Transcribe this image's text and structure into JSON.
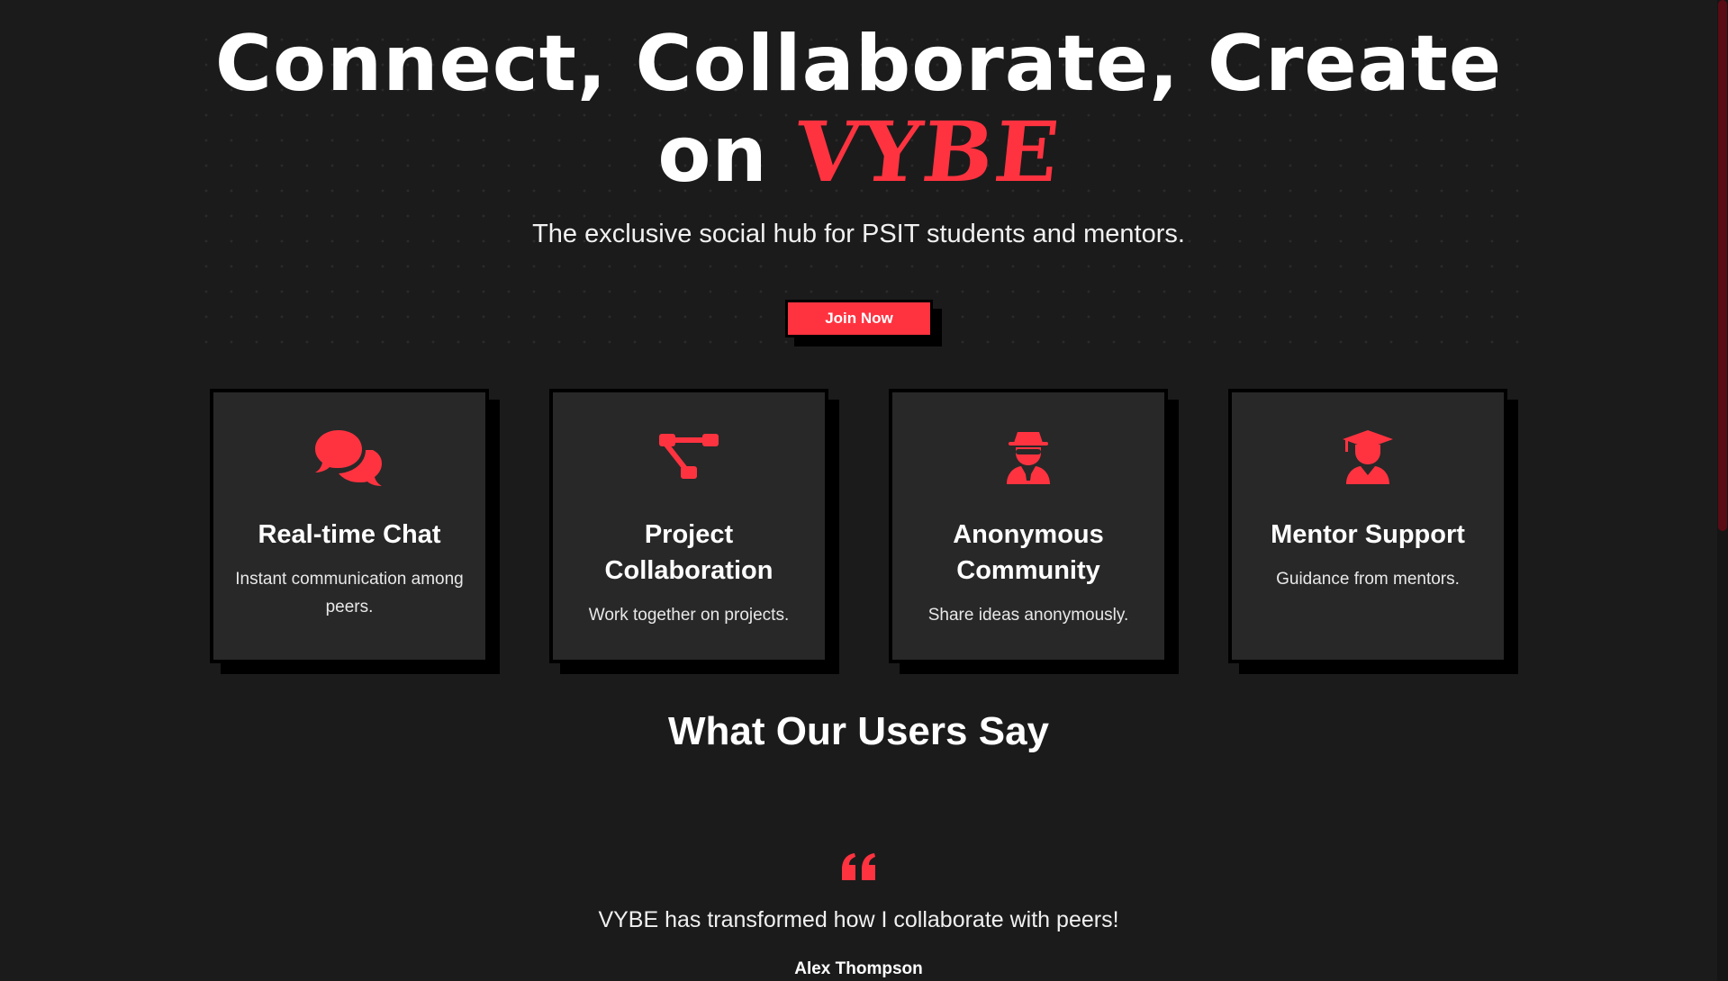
{
  "hero": {
    "title_line1": "Connect, Collaborate, Create",
    "title_line2_prefix": "on",
    "brand": "VYBE",
    "subtitle": "The exclusive social hub for PSIT students and mentors.",
    "cta_label": "Join Now"
  },
  "features": [
    {
      "icon": "chat-bubbles-icon",
      "title": "Real-time Chat",
      "description": "Instant communication among peers."
    },
    {
      "icon": "project-diagram-icon",
      "title": "Project Collaboration",
      "description": "Work together on projects."
    },
    {
      "icon": "user-secret-icon",
      "title": "Anonymous Community",
      "description": "Share ideas anonymously."
    },
    {
      "icon": "graduate-icon",
      "title": "Mentor Support",
      "description": "Guidance from mentors."
    }
  ],
  "testimonials": {
    "heading": "What Our Users Say",
    "quote_icon": "quote-left-icon",
    "items": [
      {
        "text": "VYBE has transformed how I collaborate with peers!",
        "author": "Alex Thompson"
      }
    ]
  },
  "theme": {
    "background": "#1b1b1b",
    "card_background": "#282828",
    "accent": "#ff3340",
    "shadow": "#000000",
    "scrollbar_thumb": "#5a0b14"
  }
}
